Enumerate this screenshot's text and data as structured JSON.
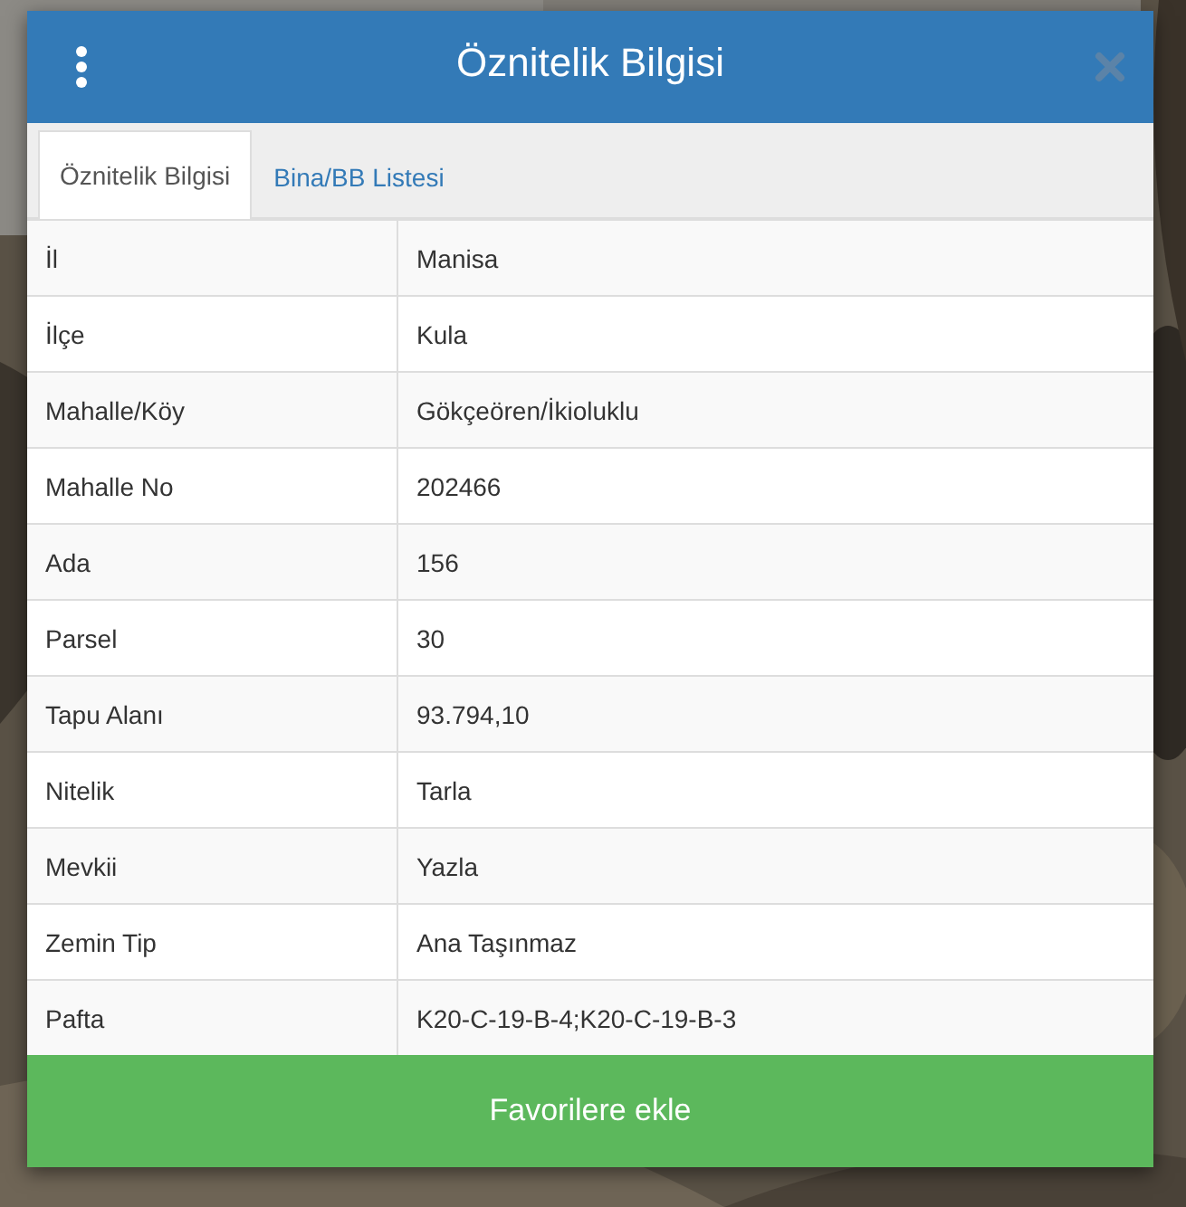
{
  "dialog": {
    "title": "Öznitelik Bilgisi"
  },
  "tabs": [
    {
      "label": "Öznitelik Bilgisi",
      "selected": true
    },
    {
      "label": "Bina/BB Listesi",
      "selected": false
    }
  ],
  "rows": [
    {
      "label": "İl",
      "value": "Manisa"
    },
    {
      "label": "İlçe",
      "value": "Kula"
    },
    {
      "label": "Mahalle/Köy",
      "value": "Gökçeören/İkioluklu"
    },
    {
      "label": "Mahalle No",
      "value": "202466"
    },
    {
      "label": "Ada",
      "value": "156"
    },
    {
      "label": "Parsel",
      "value": "30"
    },
    {
      "label": "Tapu Alanı",
      "value": "93.794,10"
    },
    {
      "label": "Nitelik",
      "value": "Tarla"
    },
    {
      "label": "Mevkii",
      "value": "Yazla"
    },
    {
      "label": "Zemin Tip",
      "value": "Ana Taşınmaz"
    },
    {
      "label": "Pafta",
      "value": "K20-C-19-B-4;K20-C-19-B-3"
    }
  ],
  "action_button": "Favorilere ekle"
}
